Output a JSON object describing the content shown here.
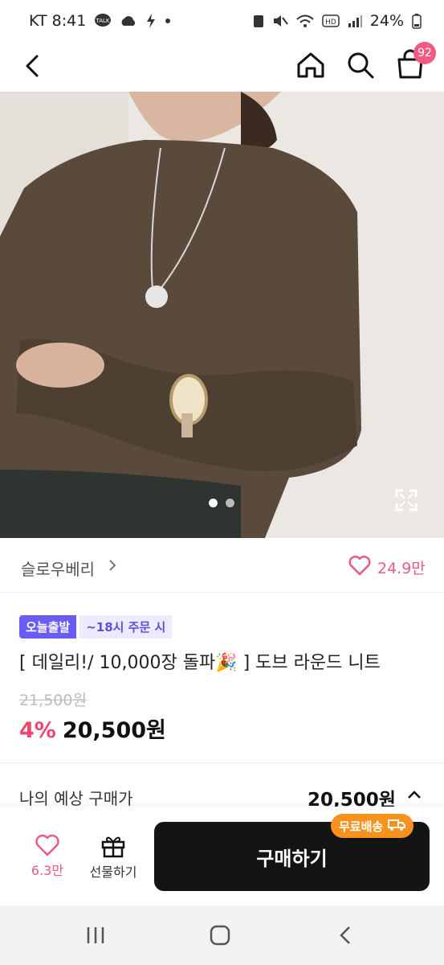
{
  "status": {
    "carrier_time": "KT 8:41",
    "battery": "24%"
  },
  "header": {
    "cart_count": "92"
  },
  "brand": {
    "name": "슬로우베리",
    "likes": "24.9만"
  },
  "tags": {
    "delivery": "오늘출발",
    "cutoff": "~18시 주문 시"
  },
  "product": {
    "title": "[ 데일리!/ 10,000장 돌파🎉 ] 도브 라운드 니트",
    "original_price": "21,500원",
    "discount": "4%",
    "price": "20,500원"
  },
  "estimate": {
    "label": "나의 예상 구매가",
    "value": "20,500원"
  },
  "bottom_bar": {
    "like_count": "6.3만",
    "gift_label": "선물하기",
    "buy_label": "구매하기",
    "ship_badge": "무료배송"
  },
  "colors": {
    "accent": "#e85b85",
    "purple": "#6a5cf6",
    "orange": "#f7921e",
    "discount": "#f0466b"
  }
}
